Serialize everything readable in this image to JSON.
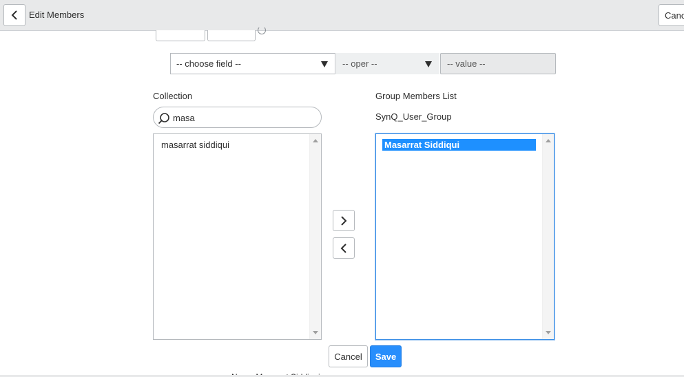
{
  "header": {
    "title": "Edit Members",
    "cancel_label": "Canc"
  },
  "filter": {
    "field_select": "-- choose field --",
    "oper_select": "-- oper --",
    "value_placeholder": "-- value --"
  },
  "collection": {
    "label": "Collection",
    "search_value": "masa",
    "items": [
      "masarrat siddiqui"
    ]
  },
  "members": {
    "label": "Group Members List",
    "group_name": "SynQ_User_Group",
    "items": [
      "Masarrat Siddiqui"
    ]
  },
  "actions": {
    "cancel_label": "Cancel",
    "save_label": "Save"
  },
  "footer": {
    "partial_text": "Name  Masarrat Siddiqui"
  },
  "colors": {
    "accent": "#278efc",
    "selection": "#1e90ff",
    "header_bg": "#e8e9ea"
  },
  "icons": {
    "back": "chevron-left-icon",
    "search": "search-icon",
    "add": "chevron-right-icon",
    "remove": "chevron-left-icon"
  }
}
